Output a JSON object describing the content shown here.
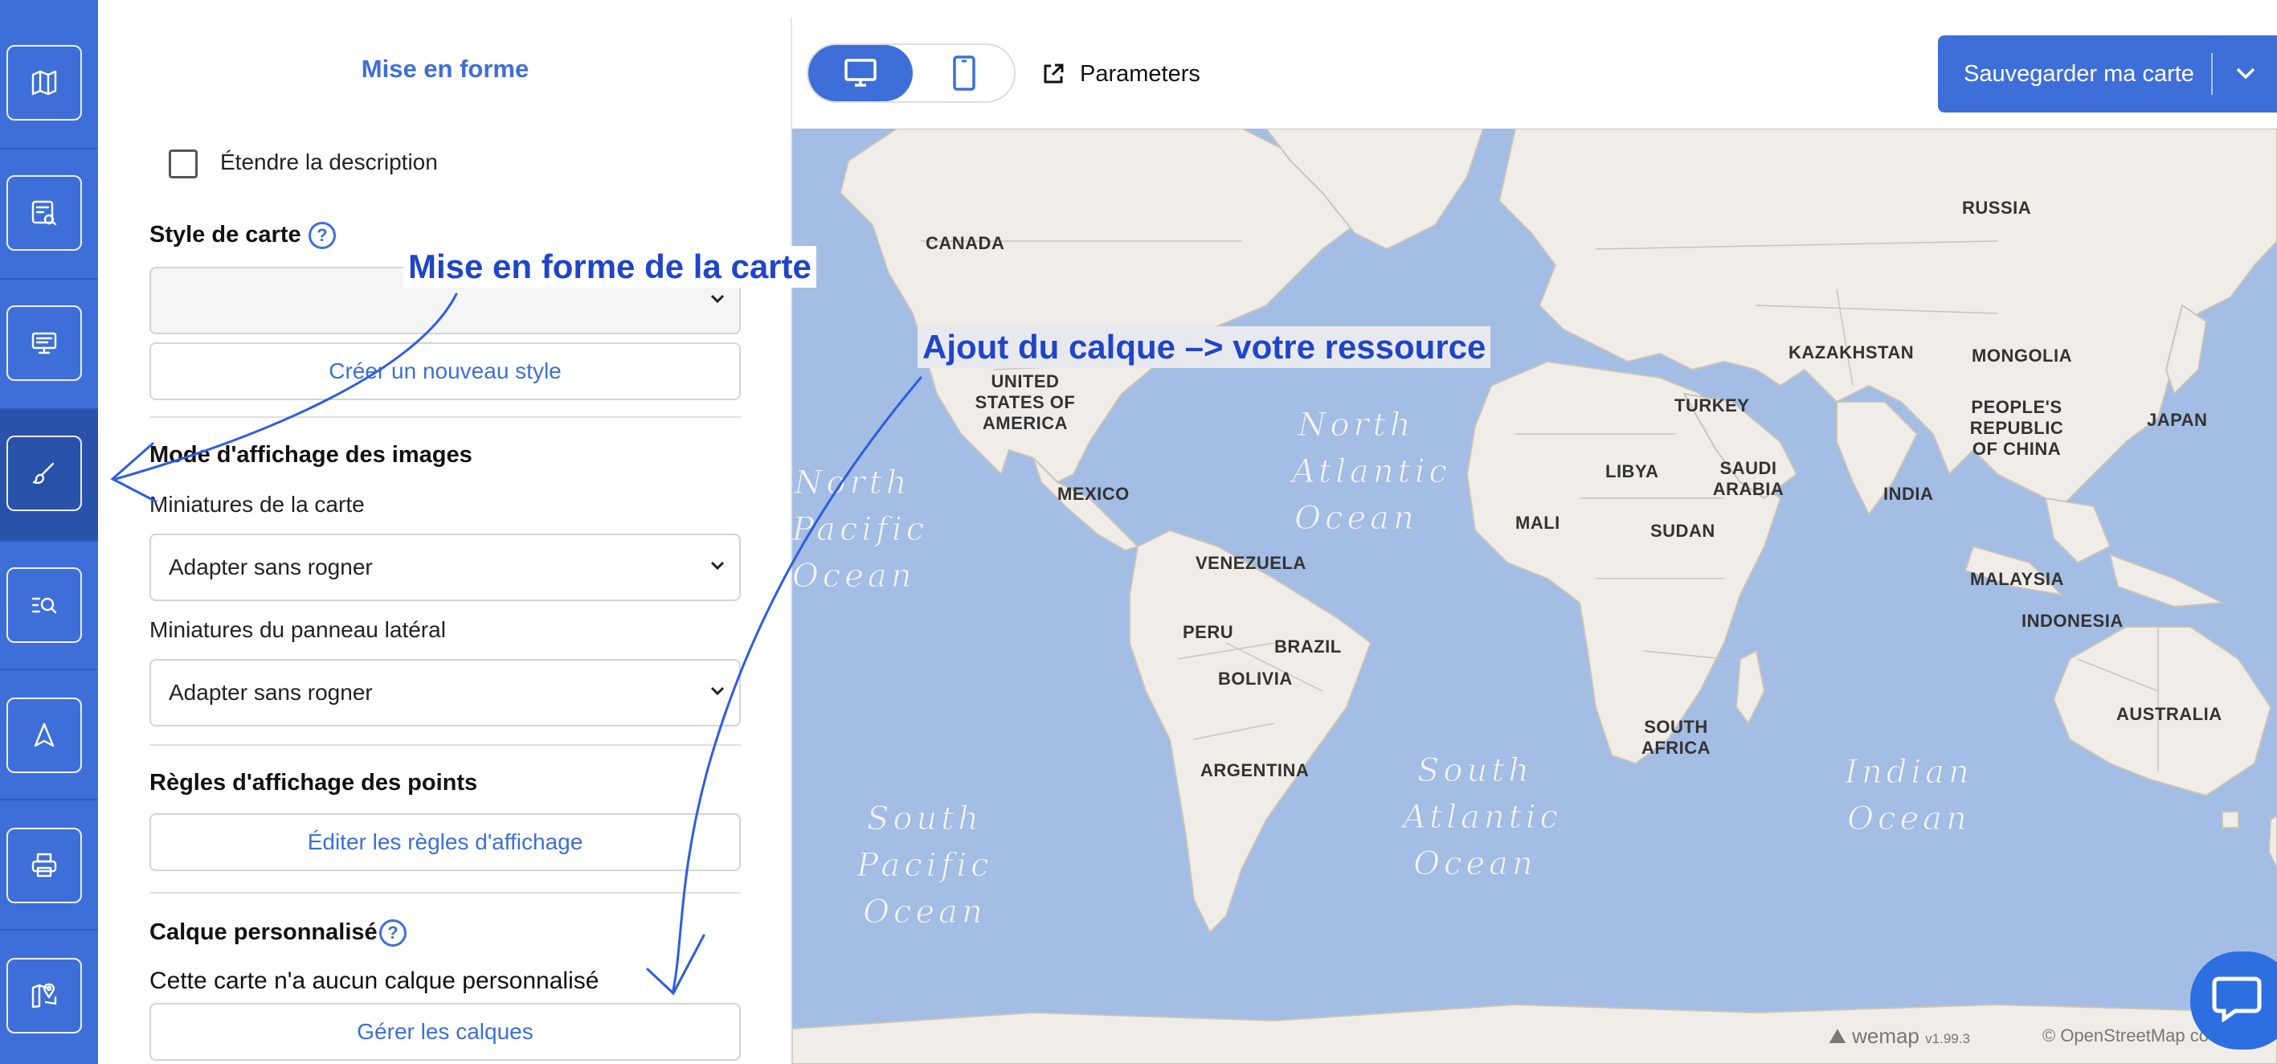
{
  "sidebar": {
    "items": [
      {
        "name": "map-icon"
      },
      {
        "name": "data-link-icon"
      },
      {
        "name": "presentation-icon"
      },
      {
        "name": "brush-icon",
        "active": true
      },
      {
        "name": "search-list-icon"
      },
      {
        "name": "navigation-arrow-icon"
      },
      {
        "name": "printer-icon"
      },
      {
        "name": "map-pin-icon"
      }
    ]
  },
  "panel": {
    "title": "Mise en forme",
    "extend_description": "Étendre la description",
    "map_style": {
      "heading": "Style de carte",
      "help": "?",
      "select_value": "",
      "create_button": "Créer un nouveau style"
    },
    "image_mode": {
      "heading": "Mode d'affichage des images",
      "map_thumbs_label": "Miniatures de la carte",
      "map_thumbs_value": "Adapter sans rogner",
      "side_thumbs_label": "Miniatures du panneau latéral",
      "side_thumbs_value": "Adapter sans rogner"
    },
    "point_rules": {
      "heading": "Règles d'affichage des points",
      "edit_button": "Éditer les règles d'affichage"
    },
    "custom_layer": {
      "heading": "Calque personnalisé",
      "help": "?",
      "empty_text": "Cette carte n'a aucun calque personnalisé",
      "manage_button": "Gérer les calques"
    }
  },
  "topbar": {
    "parameters_label": "Parameters",
    "save_label": "Sauvegarder ma carte"
  },
  "map": {
    "countries": [
      "CANADA",
      "UNITED STATES OF AMERICA",
      "MEXICO",
      "VENEZUELA",
      "PERU",
      "BRAZIL",
      "BOLIVIA",
      "ARGENTINA",
      "RUSSIA",
      "KAZAKHSTAN",
      "MONGOLIA",
      "TURKEY",
      "LIBYA",
      "SAUDI ARABIA",
      "MALI",
      "SUDAN",
      "INDIA",
      "PEOPLE'S REPUBLIC OF CHINA",
      "JAPAN",
      "MALAYSIA",
      "INDONESIA",
      "SOUTH AFRICA",
      "AUSTRALIA"
    ],
    "oceans": {
      "north_pacific": "North Pacific Ocean",
      "north_atlantic": "North Atlantic Ocean",
      "south_pacific": "South Pacific Ocean",
      "south_atlantic": "South Atlantic Ocean",
      "indian": "Indian Ocean"
    },
    "attribution_wemap": "wemap",
    "attribution_version": "v1.99.3",
    "attribution_osm": "© OpenStreetMap co"
  },
  "annotations": {
    "style_callout": "Mise en forme de la carte",
    "layer_callout": "Ajout du calque –> votre ressource"
  },
  "colors": {
    "accent": "#3e6fd8",
    "sidebar": "#3e6fd8",
    "ocean": "#a3bde4",
    "land": "#f0ede8",
    "annotation": "#1f45c8"
  }
}
